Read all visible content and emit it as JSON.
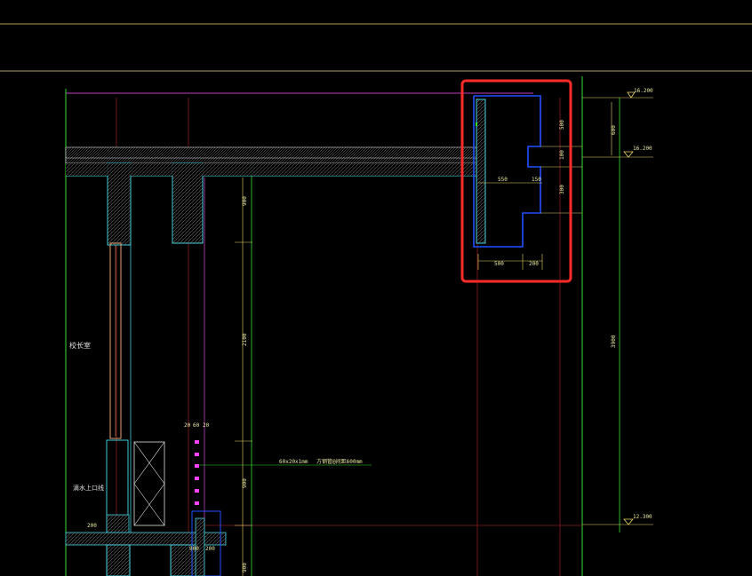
{
  "drawing": {
    "background": "#000000",
    "colors": {
      "yellow": "#e8d46a",
      "green": "#33e033",
      "magenta": "#c040c0",
      "red": "#8a1c1c",
      "cyan": "#40c8d8",
      "blue": "#2050ff",
      "white": "#e0e0e0",
      "highlight": "#ff2a2a",
      "pink": "#ff40ff"
    },
    "elevations": {
      "top": "16.200",
      "middle": "16.200",
      "bottom": "12.300"
    },
    "dims_vertical_right": {
      "d1": "600",
      "d2": "3900"
    },
    "dims_detail": {
      "v1": "500",
      "v2": "100",
      "v3": "300",
      "h1": "550",
      "h2": "150",
      "h3": "500",
      "h4": "200"
    },
    "dims_middle_column": {
      "a": "900",
      "b": "2100",
      "c": "900",
      "d": "900"
    },
    "dims_lower_left": {
      "t1": "20",
      "t2": "60",
      "t3": "20",
      "b1": "200",
      "b2": "900",
      "b3": "200"
    },
    "labels": {
      "room": "校长室",
      "note_left": "滴水上口线",
      "annotation_small": "60x20x1mm",
      "annotation_main": "方钢管@间距600mm"
    }
  }
}
